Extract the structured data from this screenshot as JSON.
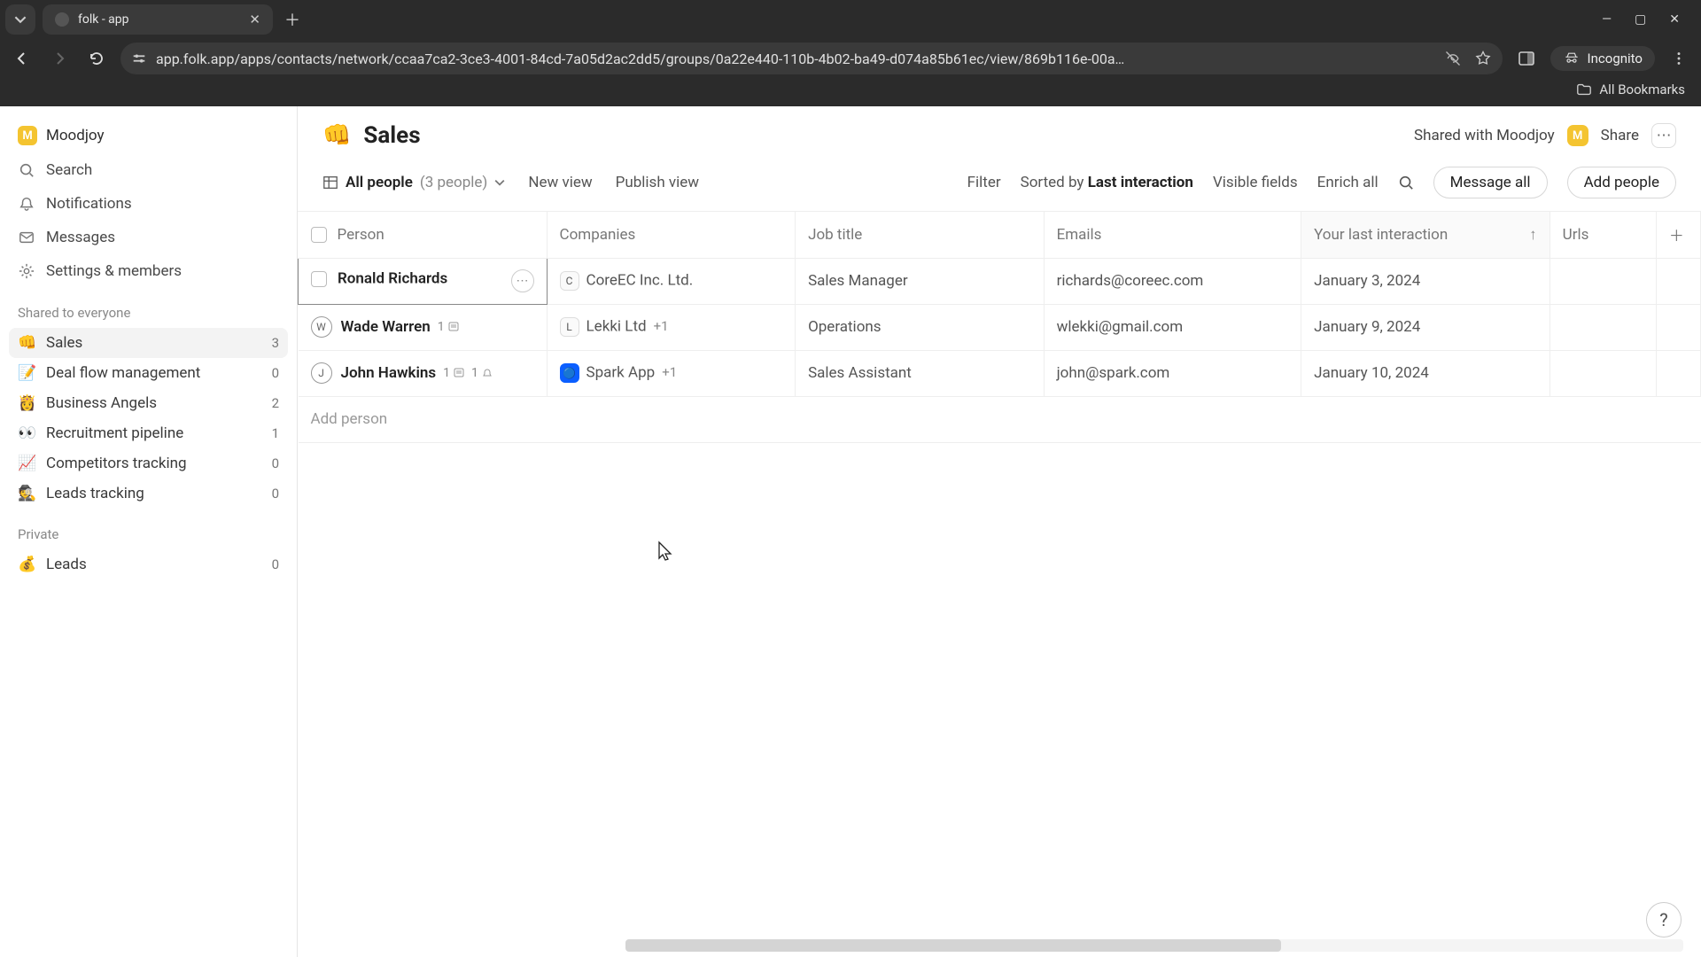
{
  "browser": {
    "tab_title": "folk - app",
    "url": "app.folk.app/apps/contacts/network/ccaa7ca2-3ce3-4001-84cd-7a05d2ac2dd5/groups/0a22e440-110b-4b02-ba49-d074a85b61ec/view/869b116e-00a…",
    "bookmarks_label": "All Bookmarks",
    "incognito_label": "Incognito"
  },
  "workspace": {
    "name": "Moodjoy",
    "initial": "M"
  },
  "nav": {
    "search": "Search",
    "notifications": "Notifications",
    "messages": "Messages",
    "settings": "Settings & members"
  },
  "sections": {
    "shared_label": "Shared to everyone",
    "private_label": "Private"
  },
  "groups_shared": [
    {
      "emoji": "👊",
      "name": "Sales",
      "count": "3",
      "active": true
    },
    {
      "emoji": "📝",
      "name": "Deal flow management",
      "count": "0"
    },
    {
      "emoji": "👸",
      "name": "Business Angels",
      "count": "2"
    },
    {
      "emoji": "👀",
      "name": "Recruitment pipeline",
      "count": "1"
    },
    {
      "emoji": "📈",
      "name": "Competitors tracking",
      "count": "0"
    },
    {
      "emoji": "🕵️",
      "name": "Leads tracking",
      "count": "0"
    }
  ],
  "groups_private": [
    {
      "emoji": "💰",
      "name": "Leads",
      "count": "0"
    }
  ],
  "page": {
    "emoji": "👊",
    "title": "Sales",
    "shared_with": "Shared with Moodjoy",
    "share": "Share"
  },
  "toolbar": {
    "view_name": "All people",
    "view_count": "(3 people)",
    "new_view": "New view",
    "publish_view": "Publish view",
    "filter": "Filter",
    "sorted_by_prefix": "Sorted by ",
    "sorted_by_value": "Last interaction",
    "visible_fields": "Visible fields",
    "enrich_all": "Enrich all",
    "message_all": "Message all",
    "add_people": "Add people"
  },
  "columns": {
    "person": "Person",
    "companies": "Companies",
    "job": "Job title",
    "emails": "Emails",
    "last": "Your last interaction",
    "urls": "Urls"
  },
  "rows": [
    {
      "initial": "",
      "name": "Ronald Richards",
      "selected": true,
      "company_badge": "C",
      "company": "CoreEC Inc. Ltd.",
      "company_more": "",
      "job": "Sales Manager",
      "email": "richards@coreec.com",
      "last": "January 3, 2024",
      "notes": "",
      "reminders": ""
    },
    {
      "initial": "W",
      "name": "Wade Warren",
      "company_badge": "L",
      "company": "Lekki Ltd",
      "company_more": "+1",
      "job": "Operations",
      "email": "wlekki@gmail.com",
      "last": "January 9, 2024",
      "notes": "1",
      "reminders": ""
    },
    {
      "initial": "J",
      "name": "John Hawkins",
      "company_badge": "🔵",
      "company_badge_class": "spark",
      "company": "Spark App",
      "company_more": "+1",
      "job": "Sales Assistant",
      "email": "john@spark.com",
      "last": "January 10, 2024",
      "notes": "1",
      "reminders": "1"
    }
  ],
  "add_person": "Add person",
  "help": "?"
}
